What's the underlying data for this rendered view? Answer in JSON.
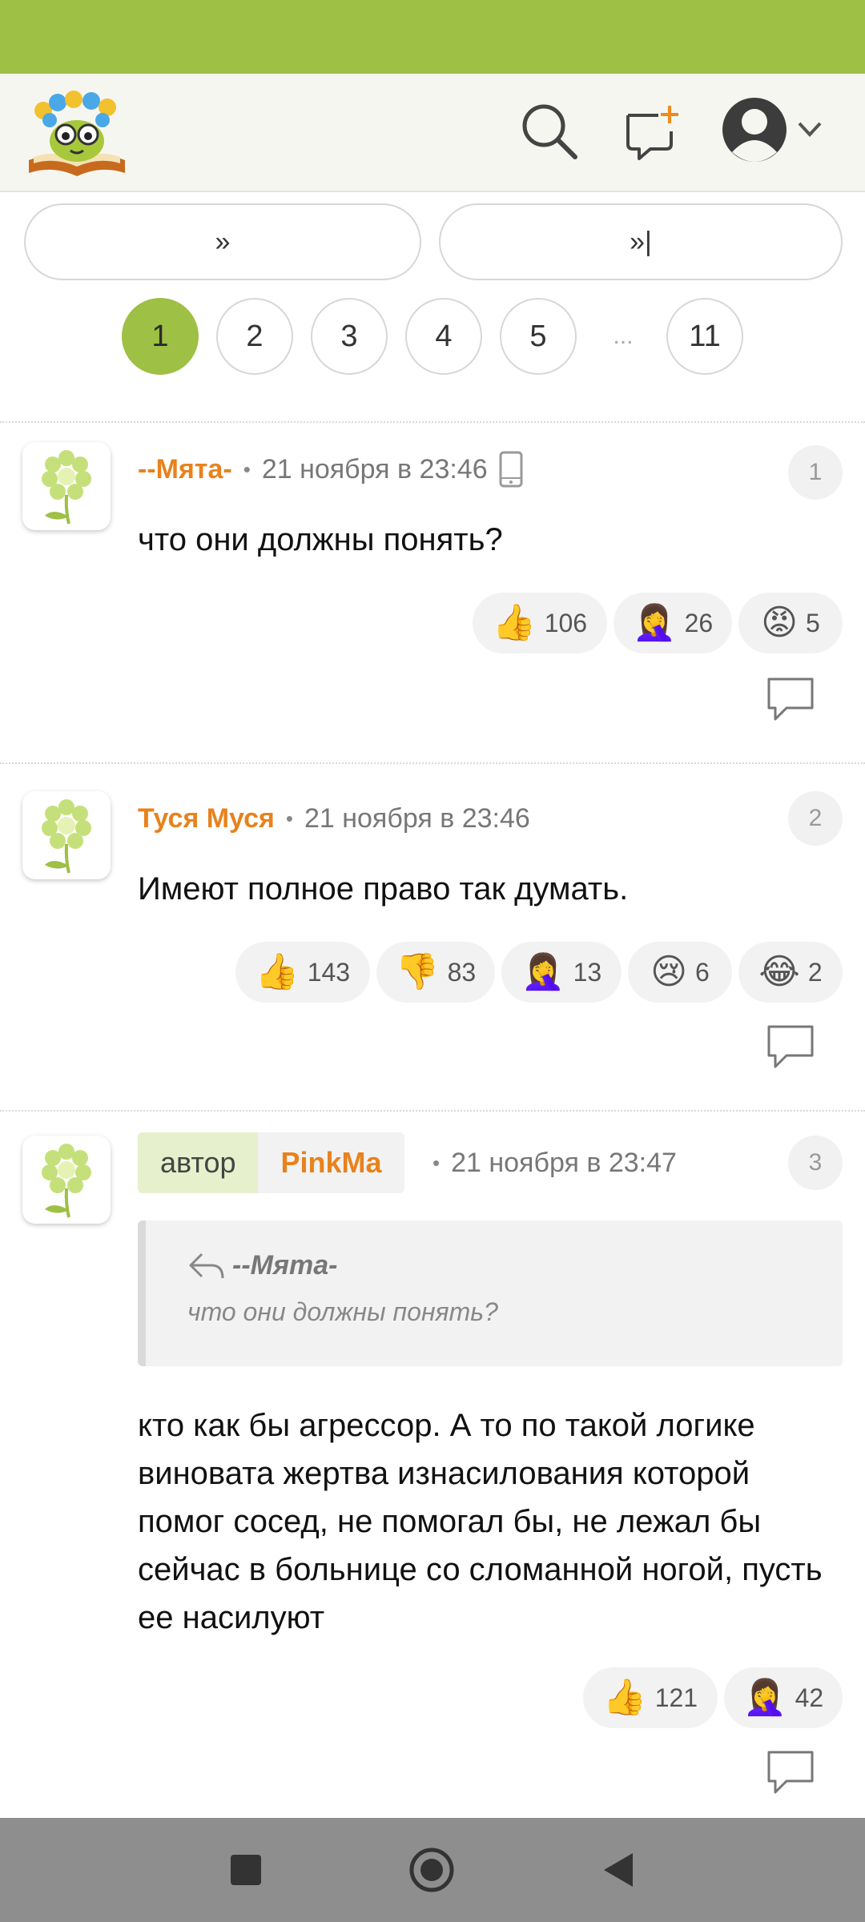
{
  "colors": {
    "accent": "#9dc045",
    "author": "#e8821c"
  },
  "pagination": {
    "next_label": "»",
    "last_label": "»|",
    "pages": [
      "1",
      "2",
      "3",
      "4",
      "5"
    ],
    "ellipsis": "...",
    "last_page": "11",
    "current": "1"
  },
  "comments": [
    {
      "author": "--Мята-",
      "date": "21 ноября в 23:46",
      "number": "1",
      "text": "что они должны понять?",
      "reactions": [
        {
          "emoji": "👍",
          "count": "106"
        },
        {
          "emoji": "🤦‍♀️",
          "count": "26"
        },
        {
          "emoji": "😡",
          "count": "5"
        }
      ]
    },
    {
      "author": "Туся Муся",
      "date": "21 ноября в 23:46",
      "number": "2",
      "text": "Имеют полное право так думать.",
      "reactions": [
        {
          "emoji": "👍",
          "count": "143"
        },
        {
          "emoji": "👎",
          "count": "83"
        },
        {
          "emoji": "🤦‍♀️",
          "count": "13"
        },
        {
          "emoji": "😢",
          "count": "6"
        },
        {
          "emoji": "😂",
          "count": "2"
        }
      ]
    },
    {
      "author_label": "автор",
      "author": "PinkMa",
      "date": "21 ноября в 23:47",
      "number": "3",
      "quote_author": "--Мята-",
      "quote_text": "что они должны понять?",
      "text": "кто как бы агрессор. А то по такой логике виновата жертва изнасилования которой помог сосед, не помогал бы, не лежал бы сейчас в больнице со сломанной ногой, пусть ее насилуют",
      "reactions": [
        {
          "emoji": "👍",
          "count": "121"
        },
        {
          "emoji": "🤦‍♀️",
          "count": "42"
        }
      ]
    }
  ]
}
